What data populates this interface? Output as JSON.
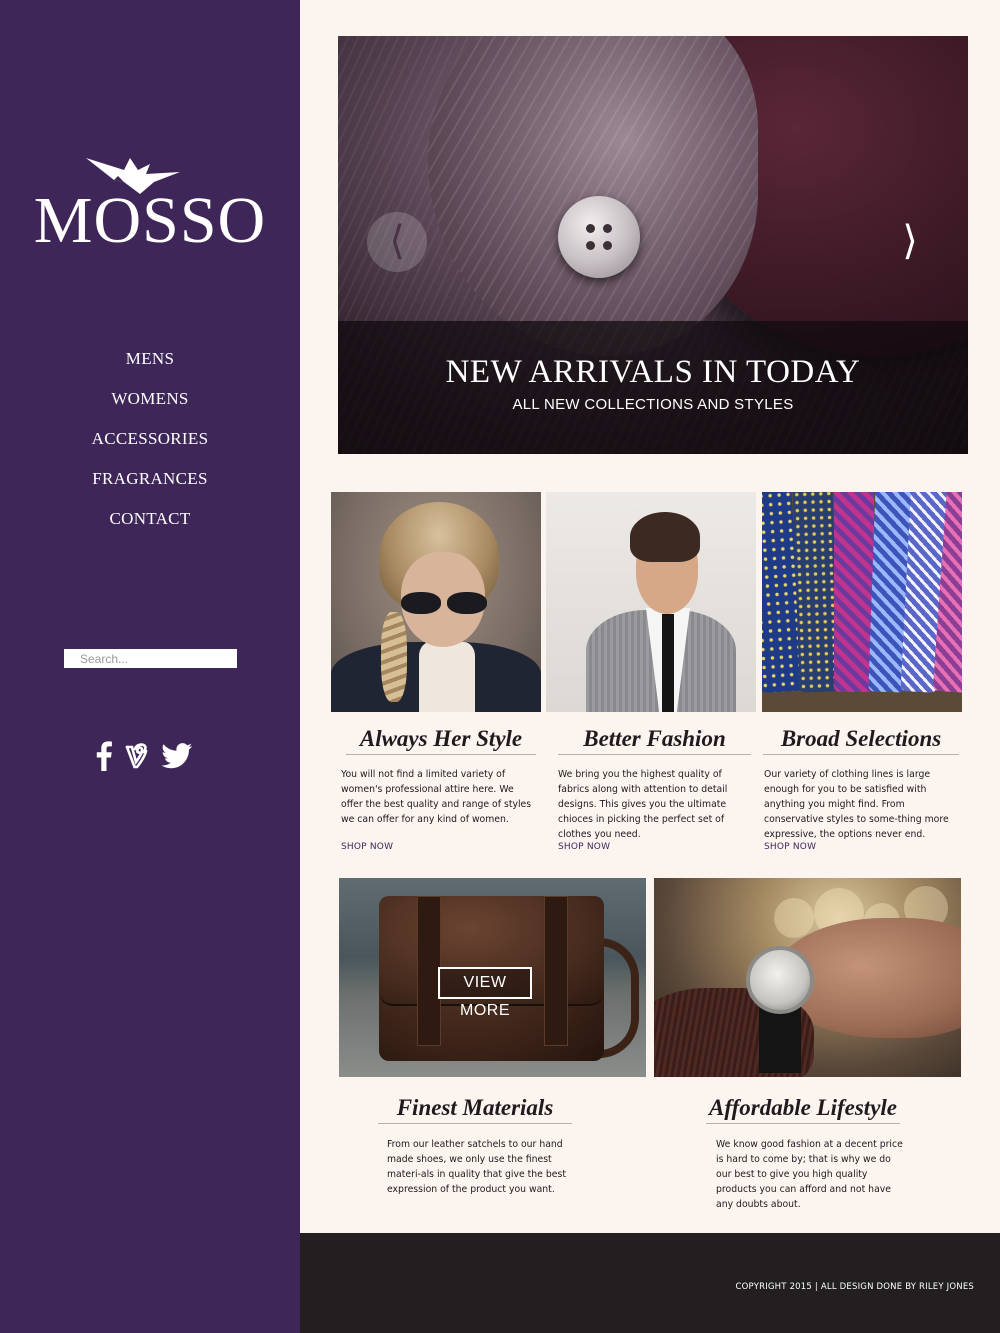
{
  "brand": {
    "name": "MOSSO"
  },
  "nav": {
    "items": [
      {
        "label": "MENS"
      },
      {
        "label": "WOMENS"
      },
      {
        "label": "ACCESSORIES"
      },
      {
        "label": "FRAGRANCES"
      },
      {
        "label": "CONTACT"
      }
    ]
  },
  "search": {
    "placeholder": "Search..."
  },
  "social": {
    "icons": [
      "facebook-icon",
      "vine-icon",
      "twitter-icon"
    ]
  },
  "hero": {
    "title": "NEW ARRIVALS IN TODAY",
    "subtitle": "ALL NEW COLLECTIONS  AND STYLES",
    "prev_label": "⟨",
    "next_label": "⟩"
  },
  "cards": [
    {
      "title": "Always Her Style",
      "text": "You will not find a limited variety of women's professional attire here. We offer the best quality and range of styles we can offer for any kind of women.",
      "link": "SHOP NOW"
    },
    {
      "title": "Better Fashion",
      "text": "We bring you the highest quality of fabrics along with attention to detail designs. This gives you the ultimate chioces in picking the perfect set of clothes you need.",
      "link": "SHOP NOW"
    },
    {
      "title": "Broad Selections",
      "text": "Our variety of clothing lines is large enough for you to be satisfied with anything you might find. From conservative styles to some-thing more expressive, the options never end.",
      "link": "SHOP NOW"
    }
  ],
  "features": [
    {
      "title": "Finest Materials",
      "text": "From our leather satchels to our hand made shoes, we only use the finest materi-als in quality that give the best expression of the product you want.",
      "button": "VIEW MORE"
    },
    {
      "title": "Affordable Lifestyle",
      "text": "We know good fashion at a decent price is hard to come by; that is why we do our best to give you high quality products you can afford and not have any doubts about."
    }
  ],
  "footer": {
    "text": "COPYRIGHT 2015 | ALL DESIGN DONE BY RILEY JONES"
  },
  "colors": {
    "sidebar": "#3f2659",
    "background": "#fcf4ef",
    "footer": "#231f20",
    "text": "#1e1a1e"
  }
}
